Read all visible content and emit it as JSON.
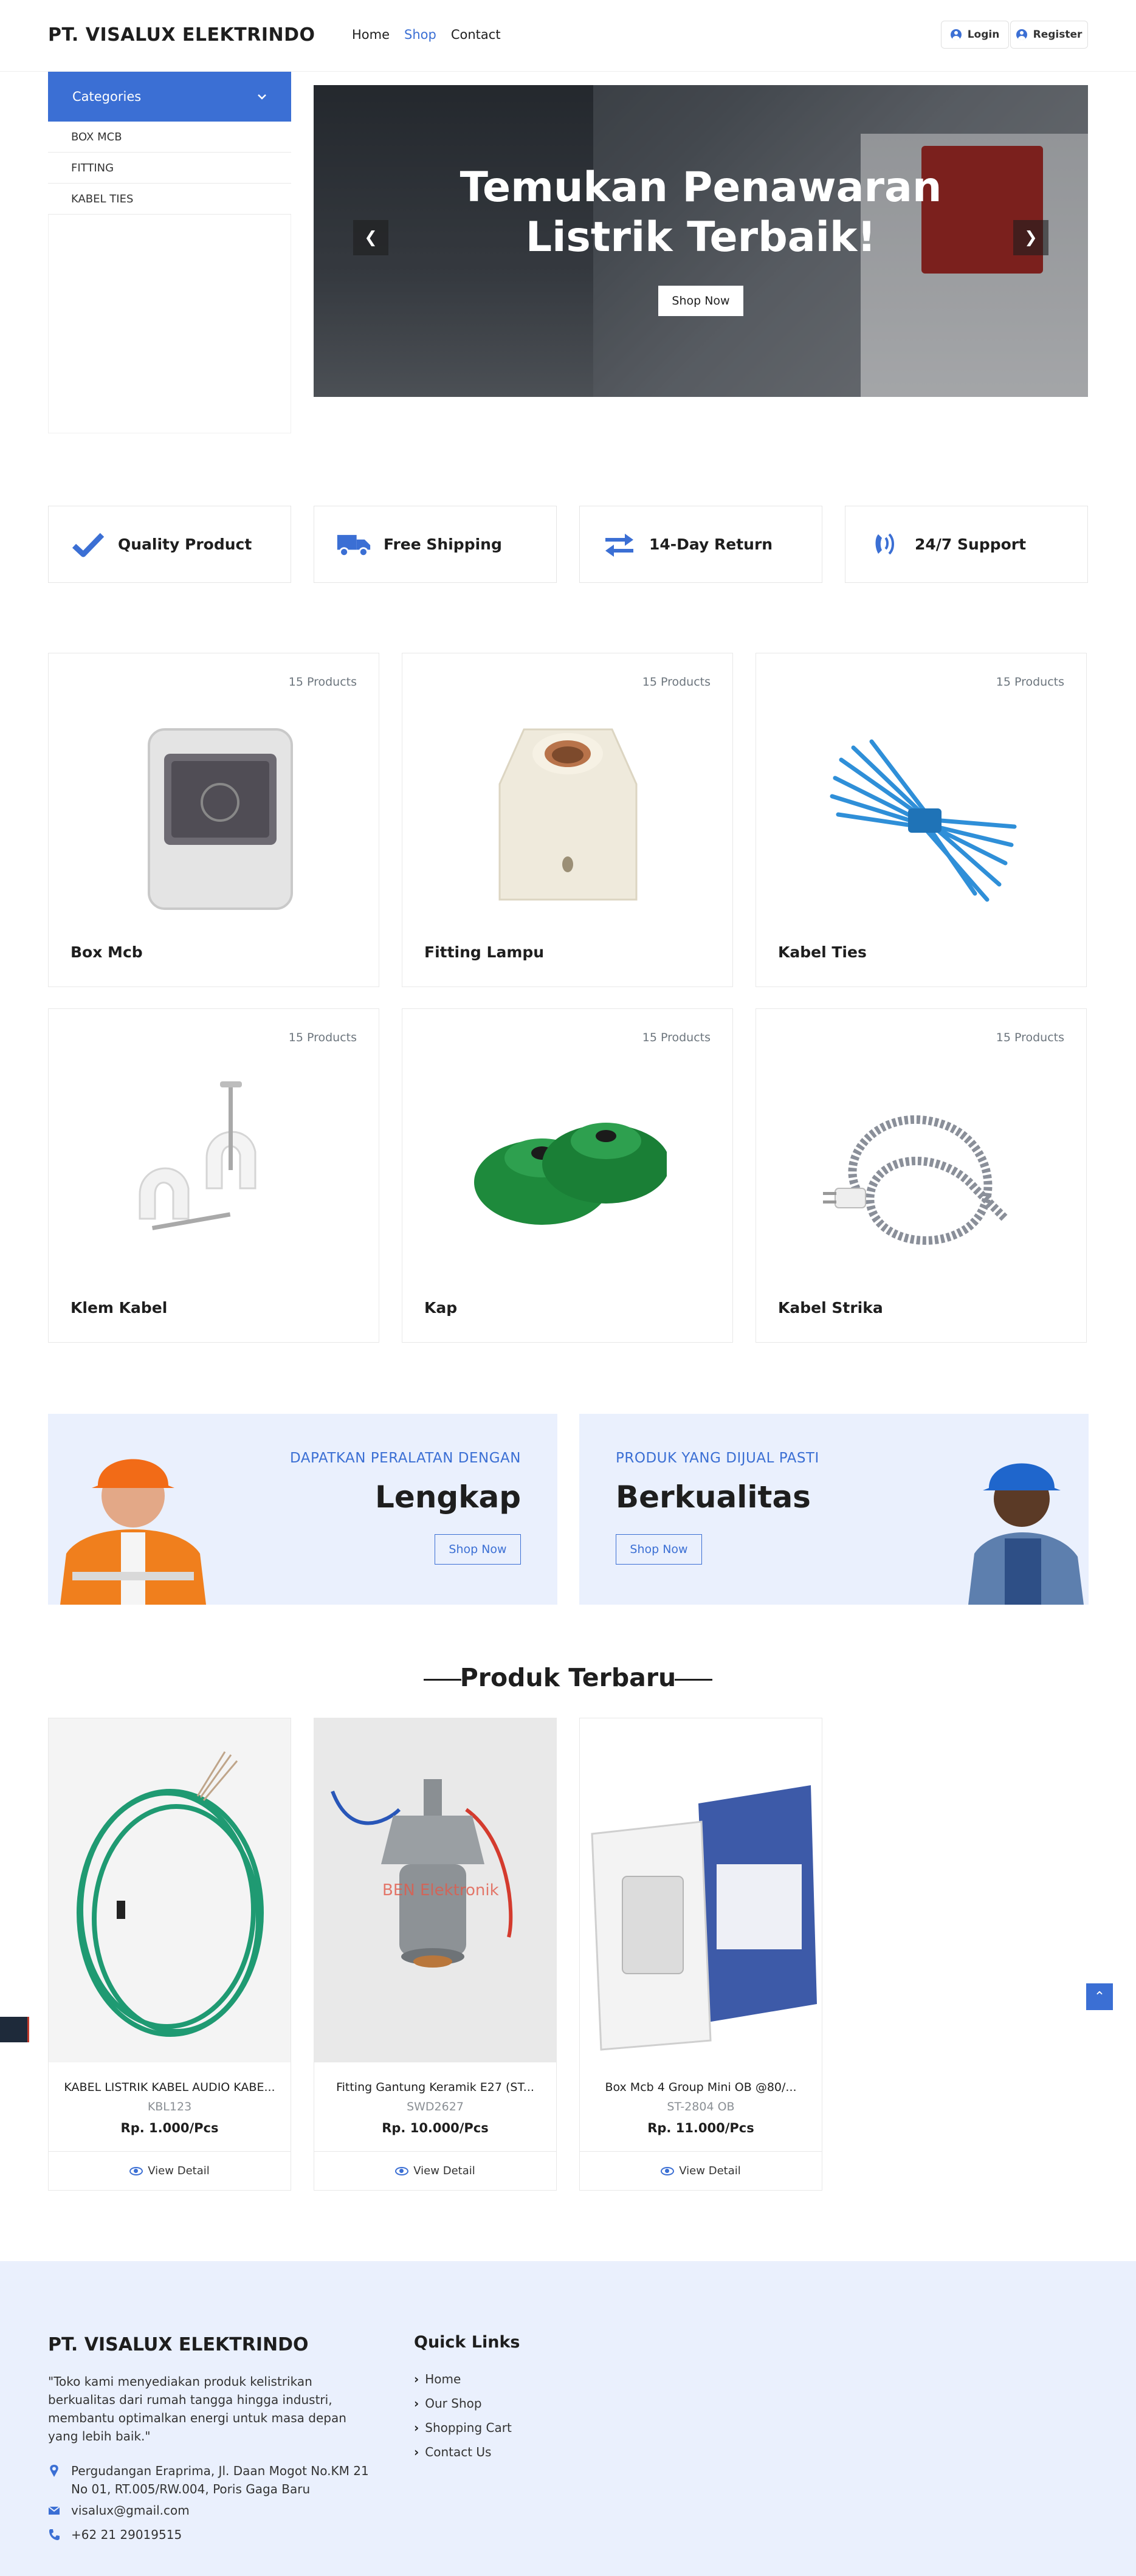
{
  "header": {
    "brand": "PT. VISALUX ELEKTRINDO",
    "nav": [
      "Home",
      "Shop",
      "Contact"
    ],
    "login": "Login",
    "register": "Register"
  },
  "sidebar": {
    "title": "Categories",
    "items": [
      "BOX MCB",
      "FITTING",
      "KABEL TIES"
    ]
  },
  "hero": {
    "title_line1": "Temukan Penawaran",
    "title_line2": "Listrik Terbaik!",
    "button": "Shop Now"
  },
  "features": [
    "Quality Product",
    "Free Shipping",
    "14-Day Return",
    "24/7 Support"
  ],
  "categories": [
    {
      "name": "Box Mcb",
      "count": "15 Products"
    },
    {
      "name": "Fitting Lampu",
      "count": "15 Products"
    },
    {
      "name": "Kabel Ties",
      "count": "15 Products"
    },
    {
      "name": "Klem Kabel",
      "count": "15 Products"
    },
    {
      "name": "Kap",
      "count": "15 Products"
    },
    {
      "name": "Kabel Strika",
      "count": "15 Products"
    }
  ],
  "banners": [
    {
      "subtitle": "DAPATKAN PERALATAN DENGAN",
      "title": "Lengkap",
      "button": "Shop Now"
    },
    {
      "subtitle": "PRODUK YANG DIJUAL PASTI",
      "title": "Berkualitas",
      "button": "Shop Now"
    }
  ],
  "new_products": {
    "title": "Produk Terbaru",
    "items": [
      {
        "name": "KABEL LISTRIK KABEL AUDIO KABE...",
        "sku": "KBL123",
        "price": "Rp. 1.000/Pcs",
        "action": "View Detail"
      },
      {
        "name": "Fitting Gantung Keramik E27 (ST...",
        "sku": "SWD2627",
        "price": "Rp. 10.000/Pcs",
        "action": "View Detail",
        "watermark": "BEN Elektronik"
      },
      {
        "name": "Box Mcb 4 Group Mini OB @80/...",
        "sku": "ST-2804 OB",
        "price": "Rp. 11.000/Pcs",
        "action": "View Detail"
      }
    ]
  },
  "footer": {
    "brand": "PT. VISALUX ELEKTRINDO",
    "description": "\"Toko kami menyediakan produk kelistrikan berkualitas dari rumah tangga hingga industri, membantu optimalkan energi untuk masa depan yang lebih baik.\"",
    "address": "Pergudangan Eraprima, Jl. Daan Mogot No.KM 21 No 01, RT.005/RW.004, Poris Gaga Baru",
    "email": "visalux@gmail.com",
    "phone": "+62 21 29019515",
    "quick_links_title": "Quick Links",
    "quick_links": [
      "Home",
      "Our Shop",
      "Shopping Cart",
      "Contact Us"
    ]
  },
  "colors": {
    "accent": "#3b6fd4",
    "banner_bg": "#eaf0fd",
    "text": "#1e1e1e"
  }
}
